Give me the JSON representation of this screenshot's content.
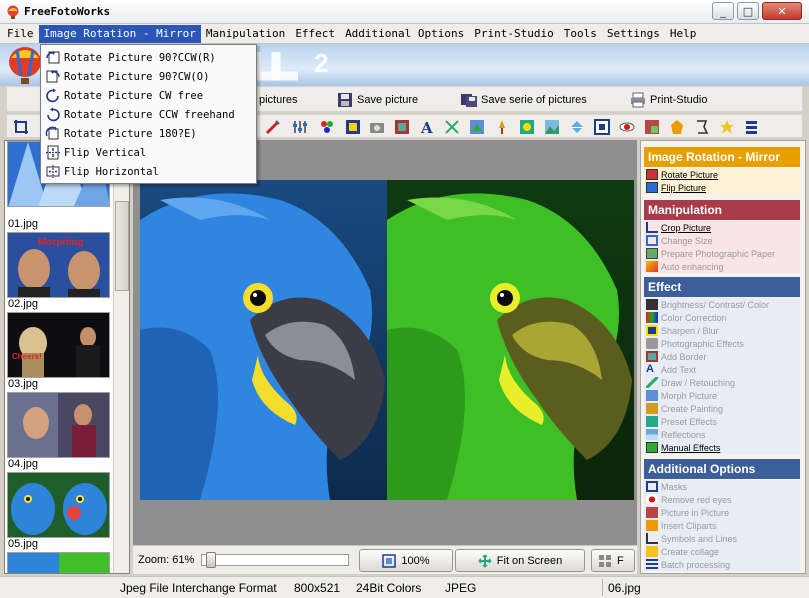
{
  "window": {
    "title": "FreeFotoWorks",
    "controls": {
      "minimize": "_",
      "maximize": "□",
      "close": "✕"
    }
  },
  "menubar": {
    "items": [
      "File",
      "Image Rotation - Mirror",
      "Manipulation",
      "Effect",
      "Additional Options",
      "Print-Studio",
      "Tools",
      "Settings",
      "Help"
    ],
    "active": "Image Rotation - Mirror"
  },
  "dropdown": {
    "items": [
      {
        "label": "Rotate Picture 90?CCW(R)",
        "icon": "rotate-ccw-icon"
      },
      {
        "label": "Rotate Picture 90?CW(O)",
        "icon": "rotate-cw-icon"
      },
      {
        "label": "Rotate Picture CW free",
        "icon": "rotate-free-cw-icon"
      },
      {
        "label": "Rotate Picture CCW freehand",
        "icon": "rotate-free-ccw-icon"
      },
      {
        "label": "Rotate Picture 180?E)",
        "icon": "rotate-180-icon"
      },
      {
        "label": "Flip Vertical",
        "icon": "flip-vertical-icon"
      },
      {
        "label": "Flip Horizontal",
        "icon": "flip-horizontal-icon"
      }
    ]
  },
  "banner": {
    "logo_number": "2"
  },
  "toolbar": {
    "load_label": "pictures",
    "save_label": "Save picture",
    "save_serie_label": "Save serie of pictures",
    "print_label": "Print-Studio"
  },
  "thumbnails": [
    {
      "label": "01.jpg"
    },
    {
      "label": "02.jpg",
      "overlay": "Morphing"
    },
    {
      "label": "03.jpg",
      "overlay": "Cheers!"
    },
    {
      "label": "04.jpg"
    },
    {
      "label": "05.jpg"
    }
  ],
  "zoom": {
    "label": "Zoom: 61%",
    "level_percent": 61,
    "btn_100": "100%",
    "btn_fit": "Fit on Screen",
    "btn_third": "F"
  },
  "taskpanel": {
    "rotation": {
      "title": "Image Rotation - Mirror",
      "color": "#e8a000",
      "items": [
        {
          "label": "Rotate Picture",
          "active": true
        },
        {
          "label": "Flip Picture",
          "active": true
        }
      ]
    },
    "manipulation": {
      "title": "Manipulation",
      "color": "#a83a4a",
      "items": [
        {
          "label": "Crop Picture",
          "active": true
        },
        {
          "label": "Change Size",
          "active": false
        },
        {
          "label": "Prepare Photographic Paper",
          "active": false
        },
        {
          "label": "Auto enhancing",
          "active": false
        }
      ]
    },
    "effect": {
      "title": "Effect",
      "color": "#3c5f9a",
      "items": [
        {
          "label": "Brightness/ Contrast/ Color",
          "active": false
        },
        {
          "label": "Color Correction",
          "active": false
        },
        {
          "label": "Sharpen / Blur",
          "active": false
        },
        {
          "label": "Photographic Effects",
          "active": false
        },
        {
          "label": "Add Border",
          "active": false
        },
        {
          "label": "Add Text",
          "active": false
        },
        {
          "label": "Draw / Retouching",
          "active": false
        },
        {
          "label": "Morph Picture",
          "active": false
        },
        {
          "label": "Create Painting",
          "active": false
        },
        {
          "label": "Preset Effects",
          "active": false
        },
        {
          "label": "Reflections",
          "active": false
        },
        {
          "label": "Manual Effects",
          "active": true
        }
      ]
    },
    "additional": {
      "title": "Additional Options",
      "color": "#3c5f9a",
      "items": [
        {
          "label": "Masks",
          "active": false
        },
        {
          "label": "Remove red eyes",
          "active": false
        },
        {
          "label": "Picture in Picture",
          "active": false
        },
        {
          "label": "Insert Cliparts",
          "active": false
        },
        {
          "label": "Symbols and Lines",
          "active": false
        },
        {
          "label": "Create collage",
          "active": false
        },
        {
          "label": "Batch processing",
          "active": false
        }
      ]
    }
  },
  "statusbar": {
    "format": "Jpeg File Interchange Format",
    "dimensions": "800x521",
    "colors": "24Bit Colors",
    "type": "JPEG",
    "filename": "06.jpg"
  }
}
